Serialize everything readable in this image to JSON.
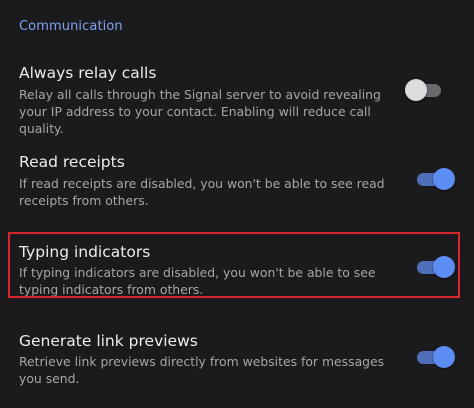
{
  "section": {
    "title": "Communication"
  },
  "settings": [
    {
      "title": "Always relay calls",
      "description": "Relay all calls through the Signal server to avoid revealing your IP address to your contact. Enabling will reduce call quality.",
      "enabled": false
    },
    {
      "title": "Read receipts",
      "description": "If read receipts are disabled, you won't be able to see read receipts from others.",
      "enabled": true
    },
    {
      "title": "Typing indicators",
      "description": "If typing indicators are disabled, you won't be able to see typing indicators from others.",
      "enabled": true,
      "highlighted": true
    },
    {
      "title": "Generate link previews",
      "description": "Retrieve link previews directly from websites for messages you send.",
      "enabled": true
    }
  ],
  "colors": {
    "accent": "#5c8df3",
    "highlight_border": "#d6262f",
    "background": "#1b1b1d"
  }
}
